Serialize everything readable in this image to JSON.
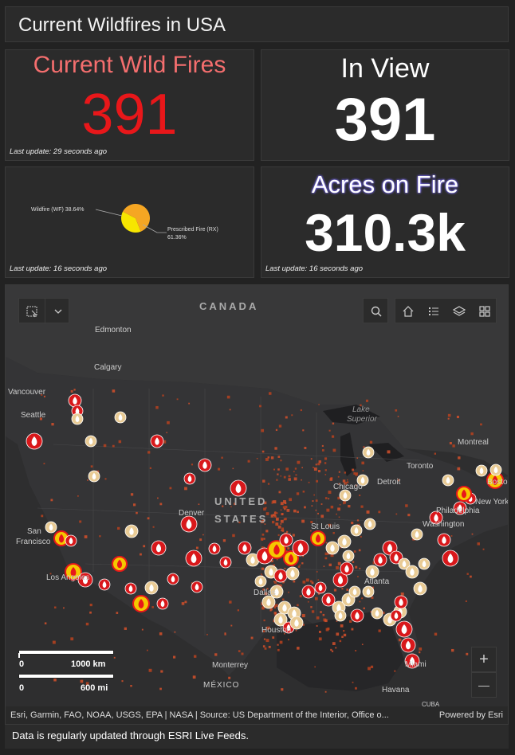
{
  "header": {
    "title": "Current Wildfires in USA"
  },
  "cards": {
    "current": {
      "title": "Current Wild Fires",
      "value": "391",
      "update": "Last update: 29 seconds ago",
      "title_color": "#f46e6e",
      "value_color": "#e8171a"
    },
    "in_view": {
      "title": "In View",
      "value": "391"
    },
    "pie": {
      "update": "Last update: 16 seconds ago",
      "labels": {
        "wildfire": "Wildfire (WF) 38.64%",
        "prescribed_line1": "Prescribed Fire (RX)",
        "prescribed_line2": "61.36%"
      },
      "colors": {
        "wildfire": "#f7e600",
        "prescribed": "#f5a623"
      }
    },
    "acres": {
      "title": "Acres on Fire",
      "value": "310.3k",
      "update": "Last update: 16 seconds ago",
      "title_glow": "#7b6cff"
    }
  },
  "chart_data": {
    "type": "pie",
    "slices": [
      {
        "label": "Wildfire (WF)",
        "value": 38.64
      },
      {
        "label": "Prescribed Fire (RX)",
        "value": 61.36
      }
    ]
  },
  "map": {
    "labels": {
      "canada": "CANADA",
      "united": "UNITED",
      "states": "STATES",
      "mexico": "MÉXICO",
      "edmonton": "Edmonton",
      "calgary": "Calgary",
      "vancouver": "Vancouver",
      "seattle": "Seattle",
      "san": "San",
      "francisco": "Francisco",
      "los_angeles": "Los Angeles",
      "denver": "Denver",
      "dallas": "Dallas",
      "houston": "Houston",
      "monterrey": "Monterrey",
      "st_louis": "St Louis",
      "chicago": "Chicago",
      "detroit": "Detroit",
      "toronto": "Toronto",
      "montreal": "Montreal",
      "boston": "Bosto",
      "new_york": "New York",
      "philadelphia": "Philadelphia",
      "washington": "Washington",
      "atlanta": "Atlanta",
      "miami": "Miami",
      "havana": "Havana",
      "cuba": "CUBA",
      "lake": "Lake",
      "superior": "Superior"
    },
    "scale": {
      "km_zero": "0",
      "km": "1000 km",
      "mi_zero": "0",
      "mi": "600 mi"
    },
    "attribution": "Esri, Garmin, FAO, NOAA, USGS, EPA | NASA | Source: US Department of the Interior, Office o...",
    "powered": "Powered by Esri",
    "zoom_in": "+",
    "zoom_out": "—"
  },
  "footer": {
    "text": "Data is regularly updated through ESRI Live Feeds."
  }
}
